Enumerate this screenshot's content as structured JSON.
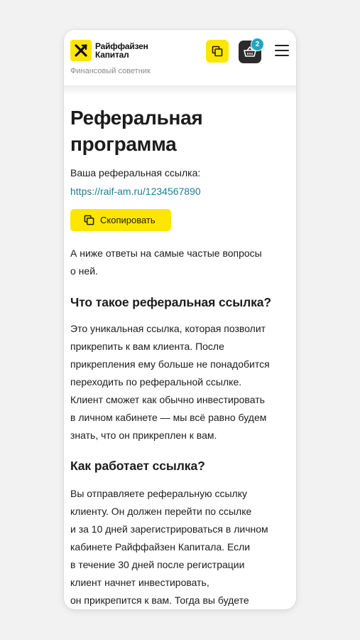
{
  "header": {
    "logo_line1": "Райффайзен",
    "logo_line2": "Капитал",
    "subtitle": "Финансовый советник",
    "basket_count": "2"
  },
  "page": {
    "title_line1": "Реферальная",
    "title_line2": "программа",
    "ref_label": "Ваша реферальная ссылка:",
    "ref_link": "https://raif-am.ru/1234567890",
    "copy_button": "Скопировать",
    "intro_line1": "А ниже ответы на самые частые вопросы",
    "intro_line2": "о ней."
  },
  "faq": [
    {
      "question": "Что такое реферальная ссылка?",
      "lines": [
        "Это уникальная ссылка, которая позволит",
        "прикрепить к вам клиента. После",
        "прикрепления ему больше не понадобится",
        "переходить по реферальной ссылке.",
        "Клиент сможет как обычно инвестировать",
        "в личном кабинете — мы всё равно будем",
        "знать, что он прикреплен к вам."
      ]
    },
    {
      "question": "Как работает ссылка?",
      "lines": [
        "Вы отправляете реферальную ссылку",
        "клиенту. Он должен перейти по ссылке",
        "и за 10 дней зарегистрироваться в личном",
        "кабинете Райффайзен Капитала. Если",
        "в течение 30 дней после регистрации",
        "клиент начнет инвестировать,",
        "он прикрепится к вам. Тогда вы будете"
      ]
    }
  ],
  "colors": {
    "brand_yellow": "#fee600",
    "link": "#1b7f97",
    "badge": "#1fa7c4"
  }
}
